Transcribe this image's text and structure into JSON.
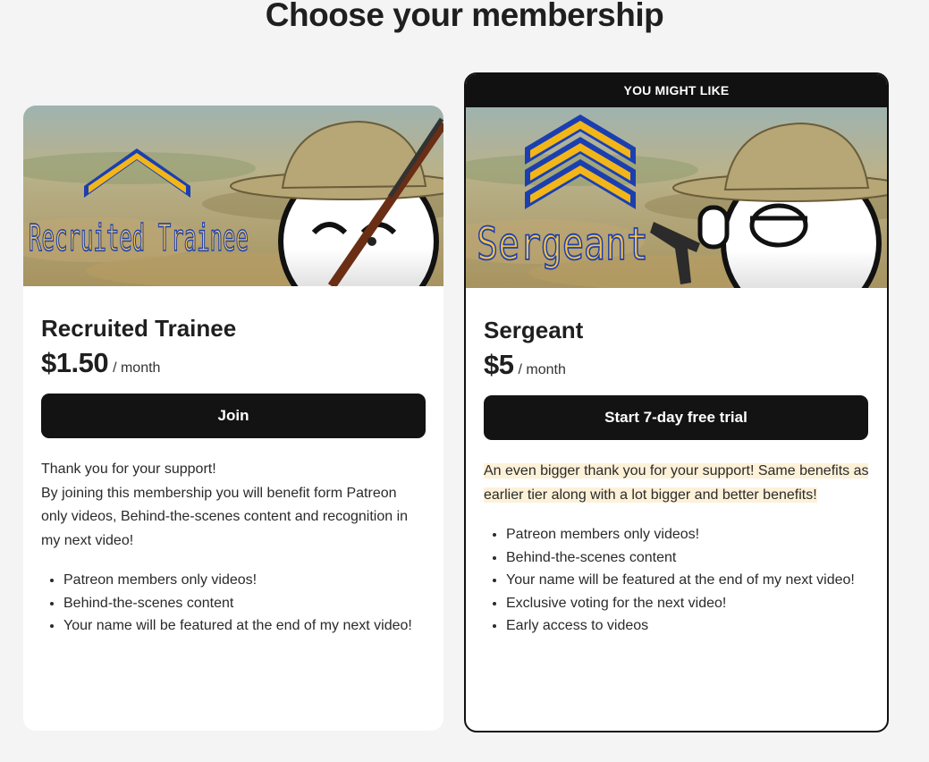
{
  "page": {
    "title": "Choose your membership"
  },
  "tiers": [
    {
      "name": "Recruited Trainee",
      "banner_text": "Recruited Trainee",
      "price": "$1.50",
      "period": "/ month",
      "cta_label": "Join",
      "description": [
        "Thank you for your support!",
        "By joining this membership you will benefit form Patreon only videos, Behind-the-scenes content and recognition in my next video!"
      ],
      "perks": [
        "Patreon members only videos!",
        "Behind-the-scenes content",
        "Your name will be featured at the end of my next video!"
      ]
    },
    {
      "ribbon": "YOU MIGHT LIKE",
      "name": "Sergeant",
      "banner_text": "Sergeant",
      "price": "$5",
      "period": "/ month",
      "cta_label": "Start 7-day free trial",
      "description": "An even bigger thank you for your support! Same benefits as earlier tier along with a lot bigger and better benefits!",
      "perks": [
        "Patreon members only videos!",
        "Behind-the-scenes content",
        "Your name will be featured at the end of my next video!",
        "Exclusive voting for the next video!",
        "Early access to videos"
      ]
    }
  ],
  "colors": {
    "background": "#f4f4f4",
    "button": "#131313",
    "highlight": "#fdf1d8",
    "chevron_gold": "#f2b619",
    "chevron_blue": "#1b3fb0"
  }
}
